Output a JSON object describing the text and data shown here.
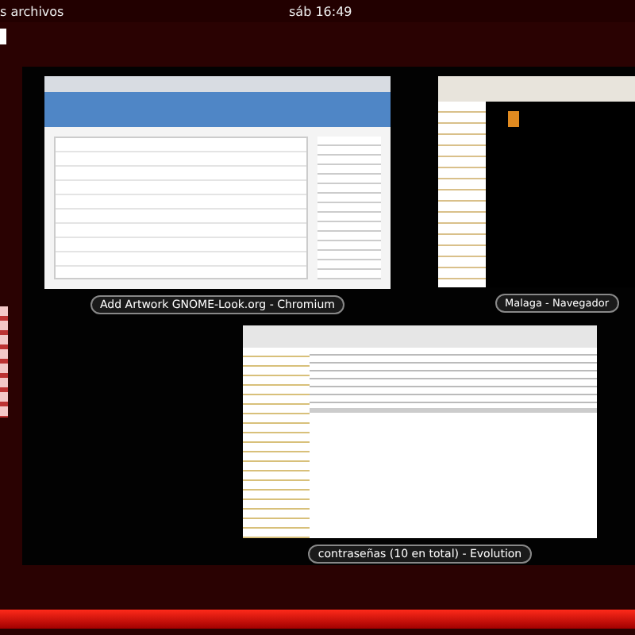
{
  "top_bar": {
    "menu_text": "s archivos",
    "clock": "sáb 16:49"
  },
  "windows": [
    {
      "kind": "browser",
      "caption": "Add  Artwork GNOME-Look.org - Chromium"
    },
    {
      "kind": "files",
      "caption": "Malaga - Navegador"
    },
    {
      "kind": "mail",
      "caption": "contraseñas (10 en total) - Evolution"
    }
  ]
}
